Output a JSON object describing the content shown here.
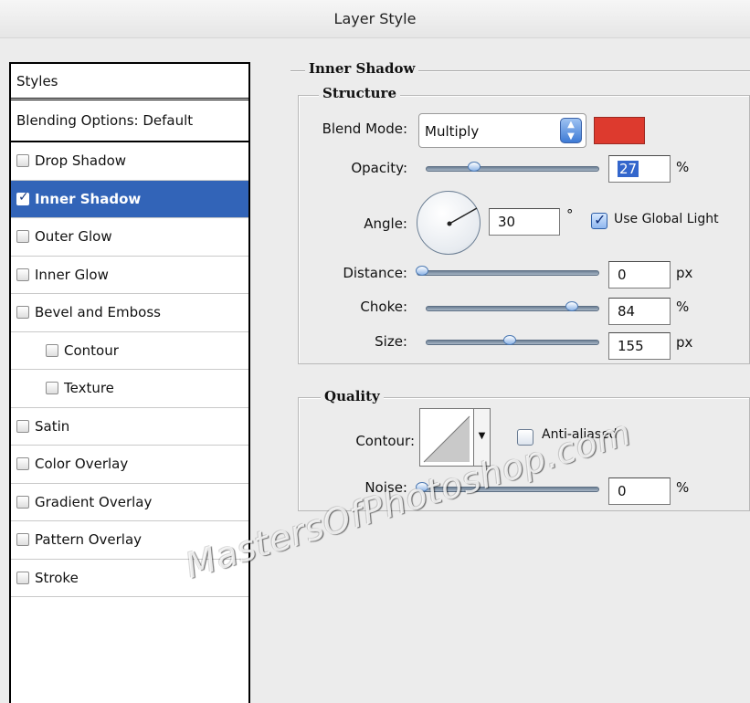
{
  "window": {
    "title": "Layer Style"
  },
  "sidebar": {
    "header": "Styles",
    "blending": "Blending Options: Default",
    "items": [
      {
        "label": "Drop Shadow",
        "checked": false,
        "selected": false,
        "indent": false
      },
      {
        "label": "Inner Shadow",
        "checked": true,
        "selected": true,
        "indent": false
      },
      {
        "label": "Outer Glow",
        "checked": false,
        "selected": false,
        "indent": false
      },
      {
        "label": "Inner Glow",
        "checked": false,
        "selected": false,
        "indent": false
      },
      {
        "label": "Bevel and Emboss",
        "checked": false,
        "selected": false,
        "indent": false
      },
      {
        "label": "Contour",
        "checked": false,
        "selected": false,
        "indent": true
      },
      {
        "label": "Texture",
        "checked": false,
        "selected": false,
        "indent": true
      },
      {
        "label": "Satin",
        "checked": false,
        "selected": false,
        "indent": false
      },
      {
        "label": "Color Overlay",
        "checked": false,
        "selected": false,
        "indent": false
      },
      {
        "label": "Gradient Overlay",
        "checked": false,
        "selected": false,
        "indent": false
      },
      {
        "label": "Pattern Overlay",
        "checked": false,
        "selected": false,
        "indent": false
      },
      {
        "label": "Stroke",
        "checked": false,
        "selected": false,
        "indent": false
      }
    ]
  },
  "panel": {
    "section_title": "Inner Shadow",
    "structure": {
      "title": "Structure",
      "blend_mode_label": "Blend Mode:",
      "blend_mode_value": "Multiply",
      "shadow_color": "#dd3a2e",
      "opacity_label": "Opacity:",
      "opacity_value": "27",
      "opacity_unit": "%",
      "angle_label": "Angle:",
      "angle_value": "30",
      "angle_unit": "°",
      "use_global_light_label": "Use Global Light",
      "use_global_light": true,
      "distance_label": "Distance:",
      "distance_value": "0",
      "distance_unit": "px",
      "choke_label": "Choke:",
      "choke_value": "84",
      "choke_unit": "%",
      "size_label": "Size:",
      "size_value": "155",
      "size_unit": "px"
    },
    "quality": {
      "title": "Quality",
      "contour_label": "Contour:",
      "anti_aliased_label": "Anti-aliased",
      "anti_aliased": false,
      "noise_label": "Noise:",
      "noise_value": "0",
      "noise_unit": "%"
    }
  },
  "watermark": "MastersOfPhotoshop.com",
  "icons": {
    "checkbox": "checkbox-icon",
    "select_arrows": "updown-arrows-icon",
    "dropdown": "chevron-down-icon"
  }
}
